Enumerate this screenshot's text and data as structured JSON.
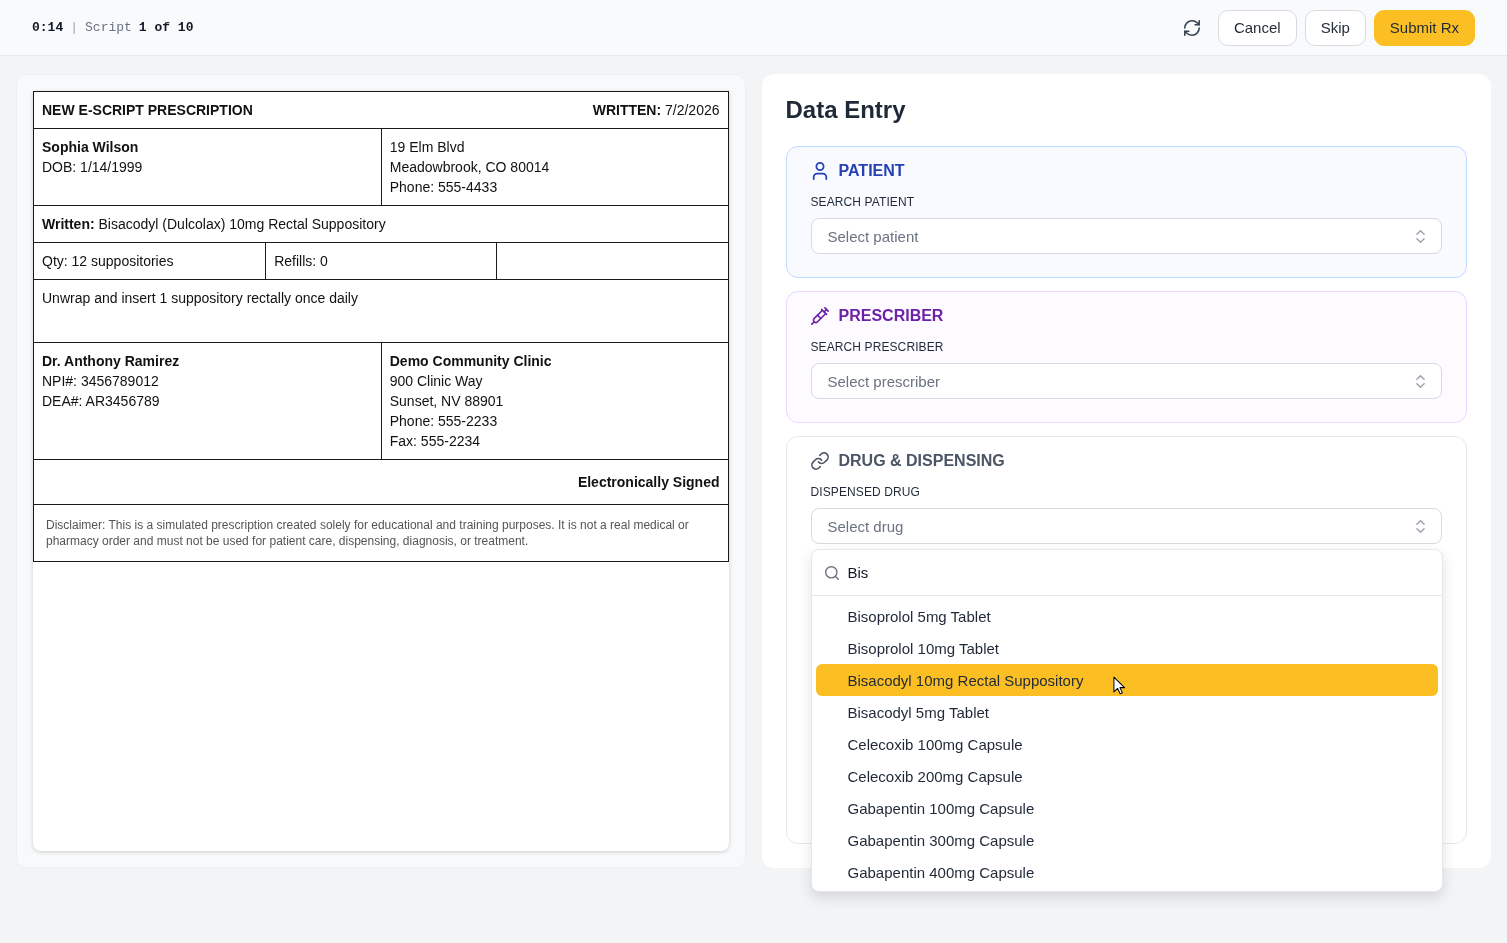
{
  "top_bar": {
    "timer": "0:14",
    "separator": "|",
    "script_label": "Script",
    "script_count": "1 of 10",
    "buttons": [
      {
        "label": "Cancel",
        "kind": "outline"
      },
      {
        "label": "Skip",
        "kind": "outline"
      },
      {
        "label": "Submit Rx",
        "kind": "primary"
      }
    ]
  },
  "prescription": {
    "title": "NEW E-SCRIPT PRESCRIPTION",
    "written_date": "**WRITTEN:** 7/2/2026",
    "patient": {
      "name": "Sophia Wilson",
      "lines": [
        "DOB: 1/14/1999"
      ]
    },
    "patient_address": [
      "19 Elm Blvd",
      "Meadowbrook, CO 80014",
      "Phone: 555-4433"
    ],
    "drug_written": "**Written:** Bisacodyl (Dulcolax) 10mg Rectal Suppository",
    "quantity": "Qty: 12 suppositories",
    "refills": "Refills: 0",
    "directions": "Unwrap and insert 1 suppository rectally once daily",
    "prescriber": {
      "name": "Dr. Anthony Ramirez",
      "lines": [
        "NPI#: 3456789012",
        "DEA#: AR3456789"
      ]
    },
    "clinic": {
      "name": "Demo Community Clinic",
      "lines": [
        "900 Clinic Way",
        "Sunset, NV 88901",
        "Phone: 555-2233",
        "Fax: 555-2234"
      ]
    },
    "signature": "Electronically Signed",
    "disclaimer": "Disclaimer: This is a simulated prescription created solely for educational and training purposes. It is not a real medical or pharmacy order and must not be used for patient care, dispensing, diagnosis, or treatment."
  },
  "data_entry": {
    "title": "Data Entry",
    "sections": [
      {
        "kind": "patient",
        "title": "PATIENT",
        "field_label": "SEARCH PATIENT",
        "placeholder": "Select patient"
      },
      {
        "kind": "prescriber",
        "title": "PRESCRIBER",
        "field_label": "SEARCH PRESCRIBER",
        "placeholder": "Select prescriber"
      },
      {
        "kind": "drug",
        "title": "DRUG & DISPENSING",
        "field_label": "DISPENSED DRUG",
        "placeholder": "Select drug",
        "dropdown": {
          "search_value": "Bis",
          "options": [
            {
              "label": "Bisoprolol 5mg Tablet",
              "selected": false
            },
            {
              "label": "Bisoprolol 10mg Tablet",
              "selected": false
            },
            {
              "label": "Bisacodyl 10mg Rectal Suppository",
              "selected": true
            },
            {
              "label": "Bisacodyl 5mg Tablet",
              "selected": false
            },
            {
              "label": "Celecoxib 100mg Capsule",
              "selected": false
            },
            {
              "label": "Celecoxib 200mg Capsule",
              "selected": false
            },
            {
              "label": "Gabapentin 100mg Capsule",
              "selected": false
            },
            {
              "label": "Gabapentin 300mg Capsule",
              "selected": false
            },
            {
              "label": "Gabapentin 400mg Capsule",
              "selected": false
            }
          ]
        }
      }
    ]
  }
}
